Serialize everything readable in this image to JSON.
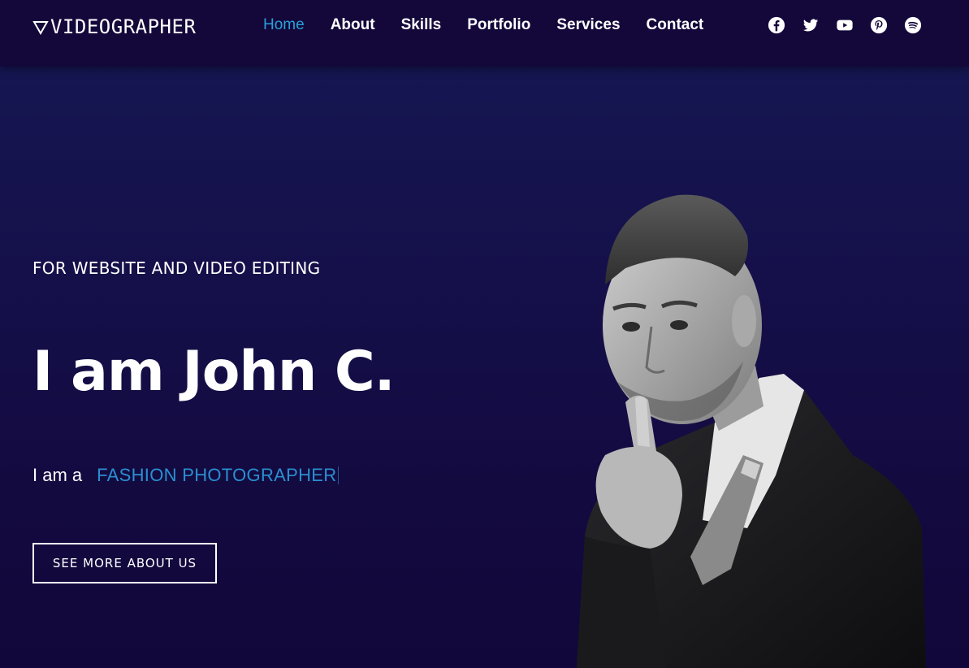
{
  "header": {
    "logo_text": "VIDEOGRAPHER",
    "nav": [
      {
        "label": "Home",
        "active": true
      },
      {
        "label": "About",
        "active": false
      },
      {
        "label": "Skills",
        "active": false
      },
      {
        "label": "Portfolio",
        "active": false
      },
      {
        "label": "Services",
        "active": false
      },
      {
        "label": "Contact",
        "active": false
      }
    ],
    "social_icons": [
      "facebook-icon",
      "twitter-icon",
      "youtube-icon",
      "pinterest-icon",
      "spotify-icon"
    ]
  },
  "hero": {
    "eyebrow": "FOR WEBSITE AND VIDEO EDITING",
    "headline": "I am John C.",
    "role_prefix": "I am a",
    "role_typed": "FASHION PHOTOGRAPHER",
    "cta_label": "SEE MORE ABOUT US",
    "image": "portrait-photo"
  },
  "colors": {
    "header_bg": "#14073a",
    "hero_bg_top": "#151652",
    "hero_bg_bottom": "#12073a",
    "accent": "#2a9fd8",
    "text": "#ffffff"
  }
}
